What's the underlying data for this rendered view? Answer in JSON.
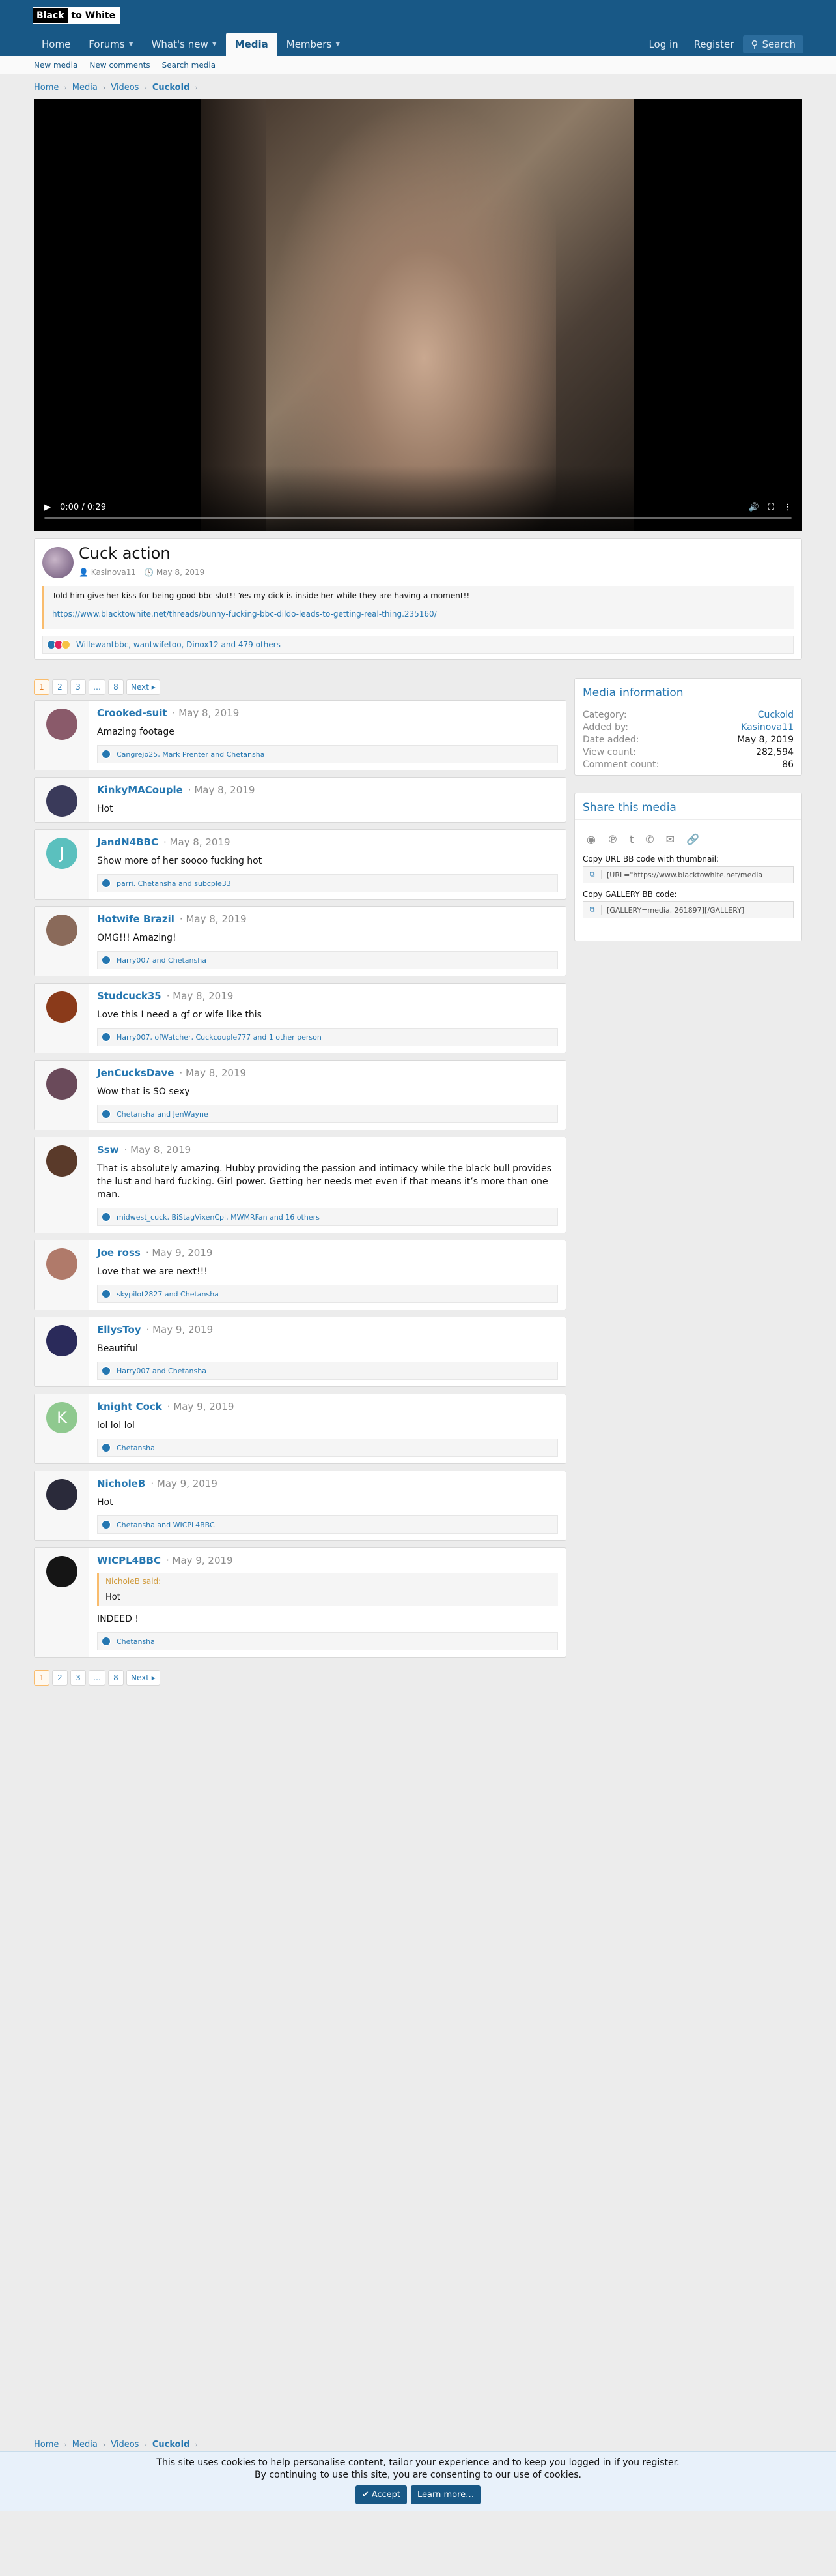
{
  "site": {
    "logo_part1": "Black",
    "logo_part2": "to White"
  },
  "nav": {
    "tabs": [
      {
        "label": "Home"
      },
      {
        "label": "Forums"
      },
      {
        "label": "What's new"
      },
      {
        "label": "Media"
      },
      {
        "label": "Members"
      }
    ],
    "login": "Log in",
    "register": "Register",
    "search": "Search"
  },
  "subnav": [
    "New media",
    "New comments",
    "Search media"
  ],
  "breadcrumb": [
    "Home",
    "Media",
    "Videos",
    "Cuckold"
  ],
  "video": {
    "time": "0:00 / 0:29"
  },
  "media": {
    "title": "Cuck action",
    "author": "Kasinova11",
    "date": "May 8, 2019",
    "description": "Told him give her kiss for being good bbc slut!! Yes my dick is inside her while they are having a moment!!",
    "link": "https://www.blacktowhite.net/threads/bunny-fucking-bbc-dildo-leads-to-getting-real-thing.235160/",
    "reactions": "Willewantbbc, wantwifetoo, Dinox12 and 479 others"
  },
  "pager": [
    "1",
    "2",
    "3",
    "…",
    "8",
    "Next ▸"
  ],
  "comments": [
    {
      "user": "Crooked-suit",
      "date": "May 8, 2019",
      "text": "Amazing footage",
      "reacts": "Cangrejo25, Mark Prenter and Chetansha",
      "avatar_color": "#8a5a6a",
      "initial": ""
    },
    {
      "user": "KinkyMACouple",
      "date": "May 8, 2019",
      "text": "Hot",
      "reacts": "",
      "avatar_color": "#3a3a5a",
      "initial": ""
    },
    {
      "user": "JandN4BBC",
      "date": "May 8, 2019",
      "text": "Show more of her soooo fucking hot",
      "reacts": "parri, Chetansha and subcple33",
      "avatar_color": "#5bc0be",
      "initial": "J"
    },
    {
      "user": "Hotwife Brazil",
      "date": "May 8, 2019",
      "text": "OMG!!! Amazing!",
      "reacts": "Harry007 and Chetansha",
      "avatar_color": "#8a6a5a",
      "initial": ""
    },
    {
      "user": "Studcuck35",
      "date": "May 8, 2019",
      "text": "Love this I need a gf or wife like this",
      "reacts": "Harry007, ofWatcher, Cuckcouple777 and 1 other person",
      "avatar_color": "#8a3a1a",
      "initial": ""
    },
    {
      "user": "JenCucksDave",
      "date": "May 8, 2019",
      "text": "Wow that is SO sexy",
      "reacts": "Chetansha and JenWayne",
      "avatar_color": "#6a4a5a",
      "initial": ""
    },
    {
      "user": "Ssw",
      "date": "May 8, 2019",
      "text": "That is absolutely amazing. Hubby providing the passion and intimacy while the black bull provides the lust and hard fucking. Girl power. Getting her needs met even if that means it’s more than one man.",
      "reacts": "midwest_cuck, BiStagVixenCpl, MWMRFan and 16 others",
      "avatar_color": "#5a3a2a",
      "initial": ""
    },
    {
      "user": "Joe ross",
      "date": "May 9, 2019",
      "text": "Love that we are next!!!",
      "reacts": "skypilot2827 and Chetansha",
      "avatar_color": "#b07a6a",
      "initial": ""
    },
    {
      "user": "EllysToy",
      "date": "May 9, 2019",
      "text": "Beautiful",
      "reacts": "Harry007 and Chetansha",
      "avatar_color": "#2a2a5a",
      "initial": ""
    },
    {
      "user": "knight Cock",
      "date": "May 9, 2019",
      "text": "lol lol lol",
      "reacts": "Chetansha",
      "avatar_color": "#8fc98f",
      "initial": "K"
    },
    {
      "user": "NicholeB",
      "date": "May 9, 2019",
      "text": "Hot",
      "reacts": "Chetansha and WICPL4BBC",
      "avatar_color": "#2a2a3a",
      "initial": ""
    },
    {
      "user": "WICPL4BBC",
      "date": "May 9, 2019",
      "quote_who": "NicholeB said:",
      "quote_text": "Hot",
      "text": "INDEED !",
      "reacts": "Chetansha",
      "avatar_color": "#151515",
      "initial": ""
    }
  ],
  "sidebar": {
    "info_title": "Media information",
    "rows": [
      {
        "k": "Category:",
        "v": "Cuckold"
      },
      {
        "k": "Added by:",
        "v": "Kasinova11"
      },
      {
        "k": "Date added:",
        "v": "May 8, 2019"
      },
      {
        "k": "View count:",
        "v": "282,594"
      },
      {
        "k": "Comment count:",
        "v": "86"
      }
    ],
    "share_title": "Share this media",
    "url_label": "Copy URL BB code with thumbnail:",
    "url_value": "[URL=\"https://www.blacktowhite.net/media",
    "gallery_label": "Copy GALLERY BB code:",
    "gallery_value": "[GALLERY=media, 261897][/GALLERY]"
  },
  "cookie": {
    "line1": "This site uses cookies to help personalise content, tailor your experience and to keep you logged in if you register.",
    "line2": "By continuing to use this site, you are consenting to our use of cookies.",
    "accept": "Accept",
    "learn": "Learn more…"
  }
}
